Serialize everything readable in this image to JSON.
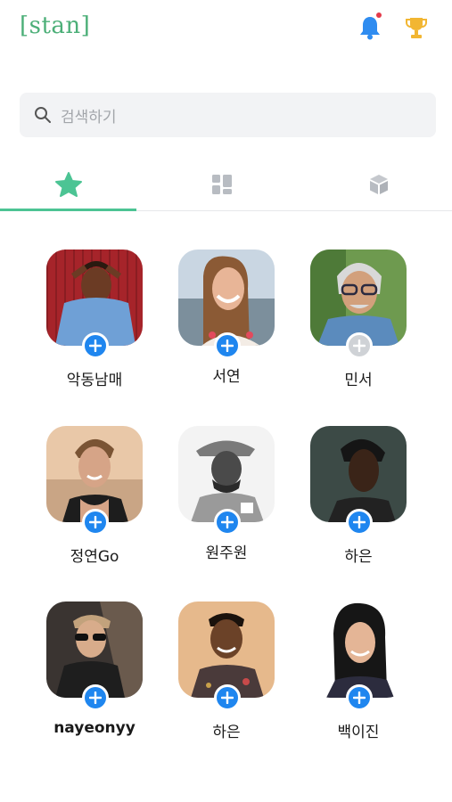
{
  "header": {
    "logo": "[stan]"
  },
  "search": {
    "placeholder": "검색하기"
  },
  "tabs": [
    {
      "icon": "star-icon",
      "active": true
    },
    {
      "icon": "grid-icon",
      "active": false
    },
    {
      "icon": "cube-icon",
      "active": false
    }
  ],
  "colors": {
    "accent": "#4cc494",
    "add": "#1f86ef",
    "logo": "#4caf78"
  },
  "artists": [
    {
      "name": "악동남매",
      "added": false
    },
    {
      "name": "서연",
      "added": false
    },
    {
      "name": "민서",
      "added": true
    },
    {
      "name": "정연Go",
      "added": false
    },
    {
      "name": "원주원",
      "added": false
    },
    {
      "name": "하은",
      "added": false
    },
    {
      "name": "nayeonyy",
      "added": false
    },
    {
      "name": "하은",
      "added": false
    },
    {
      "name": "백이진",
      "added": false
    }
  ]
}
